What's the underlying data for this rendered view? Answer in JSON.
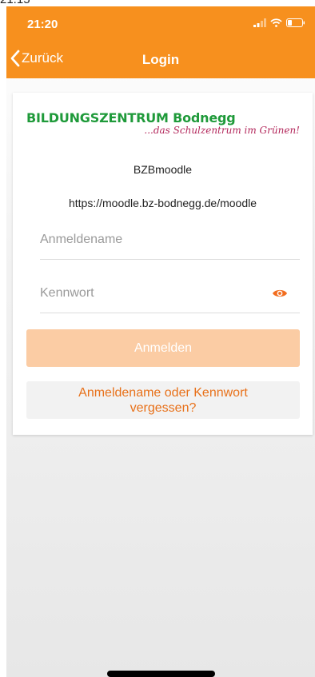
{
  "top_strip_text": "21:15",
  "status": {
    "time": "21:20"
  },
  "nav": {
    "back_label": "Zurück",
    "title": "Login"
  },
  "logo": {
    "main": "BILDUNGSZENTRUM Bodnegg",
    "sub": "...das Schulzentrum im Grünen!"
  },
  "site": {
    "name": "BZBmoodle",
    "url": "https://moodle.bz-bodnegg.de/moodle"
  },
  "form": {
    "username_placeholder": "Anmeldename",
    "password_placeholder": "Kennwort",
    "login_label": "Anmelden",
    "forgot_line1": "Anmeldename oder Kennwort",
    "forgot_line2": "vergessen?"
  },
  "colors": {
    "accent": "#f7901e",
    "logo_green": "#1f9a3a",
    "logo_magenta": "#b3275b",
    "button_disabled": "#fbcca4"
  },
  "icons": [
    "chevron-left-icon",
    "signal-icon",
    "wifi-icon",
    "battery-icon",
    "eye-icon"
  ]
}
